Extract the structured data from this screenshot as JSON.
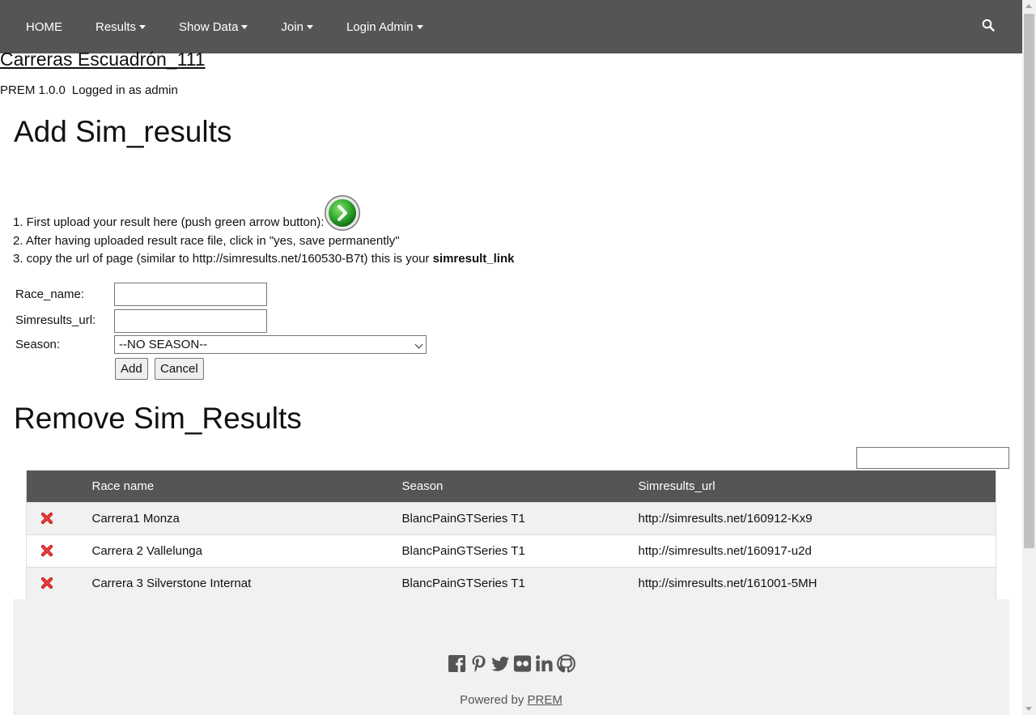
{
  "nav": {
    "home": "HOME",
    "results": "Results",
    "show_data": "Show Data",
    "join": "Join",
    "login_admin": "Login Admin"
  },
  "site": {
    "title": "Carreras Escuadrón_111",
    "version": "PREM 1.0.0",
    "logged_in": "Logged in as admin"
  },
  "add_section": {
    "heading": "Add Sim_results",
    "step1": "1. First upload your result here (push green arrow button):",
    "step2": "2. After having uploaded result race file, click in \"yes, save permanently\"",
    "step3_prefix": "3. copy the url of page (similar to http://simresults.net/160530-B7t) this is your",
    "step3_bold": "simresult_link",
    "race_name_label": "Race_name:",
    "race_name_value": "",
    "simresults_url_label": "Simresults_url:",
    "simresults_url_value": "",
    "season_label": "Season:",
    "season_selected": "--NO SEASON--",
    "add_button": "Add",
    "cancel_button": "Cancel"
  },
  "remove_section": {
    "heading": "Remove Sim_Results",
    "search_value": "",
    "columns": [
      "",
      "Race name",
      "Season",
      "Simresults_url"
    ],
    "rows": [
      {
        "race": "Carrera1 Monza",
        "season": "BlancPainGTSeries T1",
        "url": "http://simresults.net/160912-Kx9"
      },
      {
        "race": "Carrera 2 Vallelunga",
        "season": "BlancPainGTSeries T1",
        "url": "http://simresults.net/160917-u2d"
      },
      {
        "race": "Carrera 3 Silverstone Internat",
        "season": "BlancPainGTSeries T1",
        "url": "http://simresults.net/161001-5MH"
      }
    ]
  },
  "footer": {
    "powered_by": "Powered by",
    "powered_link": "PREM",
    "icons": [
      "facebook-icon",
      "pinterest-icon",
      "twitter-icon",
      "flickr-icon",
      "linkedin-icon",
      "github-icon"
    ]
  },
  "colors": {
    "navbar": "#555555",
    "table_header": "#555555",
    "footer_bg": "#f1f1f1",
    "delete_red": "#e02020",
    "arrow_green": "#2faa2f"
  }
}
